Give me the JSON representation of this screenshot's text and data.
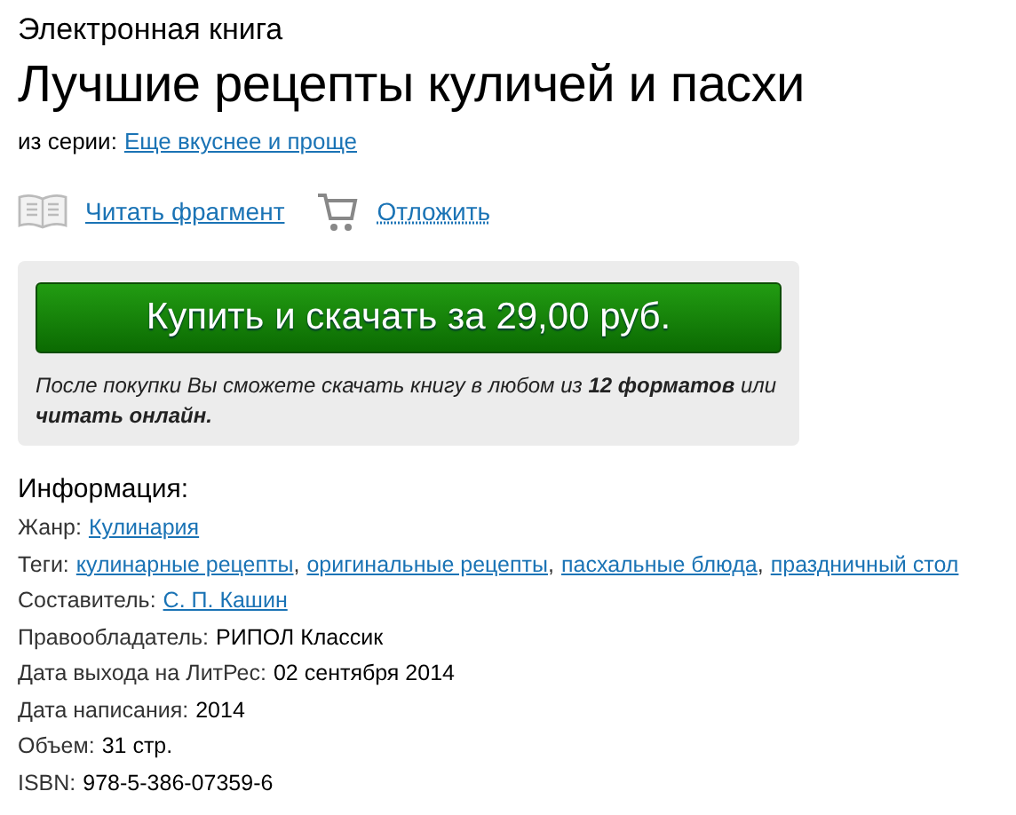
{
  "type_label": "Электронная книга",
  "title": "Лучшие рецепты куличей и пасхи",
  "series": {
    "label": "из серии:",
    "link": "Еще вкуснее и проще"
  },
  "actions": [
    {
      "kind": "read",
      "label": "Читать фрагмент"
    },
    {
      "kind": "cart",
      "label": "Отложить"
    }
  ],
  "buy": {
    "button": "Купить и скачать за 29,00 руб.",
    "note": "После покупки Вы сможете скачать книгу в любом из **12 форматов** или **читать онлайн.**"
  },
  "info": {
    "heading": "Информация:",
    "rows": [
      {
        "kind": "links",
        "label": "Жанр:",
        "links": [
          {
            "text": "Кулинария"
          }
        ]
      },
      {
        "kind": "links",
        "label": "Теги:",
        "links": [
          {
            "text": "кулинарные рецепты",
            "suffix": ","
          },
          {
            "text": "оригинальные рецепты",
            "suffix": ","
          },
          {
            "text": "пасхальные блюда",
            "suffix": ","
          },
          {
            "text": "праздничный стол"
          }
        ]
      },
      {
        "kind": "links",
        "label": "Составитель:",
        "links": [
          {
            "text": "С. П. Кашин"
          }
        ]
      },
      {
        "kind": "text",
        "label": "Правообладатель:",
        "value": "РИПОЛ Классик"
      },
      {
        "kind": "text",
        "label": "Дата выхода на ЛитРес:",
        "value": "02 сентября 2014"
      },
      {
        "kind": "text",
        "label": "Дата написания:",
        "value": "2014"
      },
      {
        "kind": "text",
        "label": "Объем:",
        "value": "31 стр."
      },
      {
        "kind": "text",
        "label": "ISBN:",
        "value": "978-5-386-07359-6"
      }
    ]
  }
}
